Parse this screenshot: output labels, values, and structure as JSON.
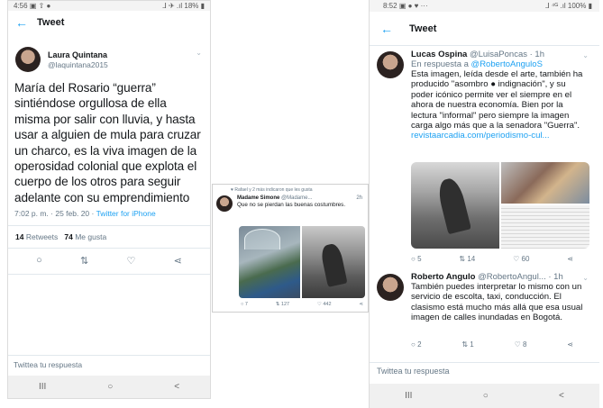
{
  "phone1": {
    "status": {
      "time": "4:56",
      "left_icons": "▣ ⇧ ●",
      "right": "⅃ ✈ .ıl 18% ▮"
    },
    "header": {
      "back": "←",
      "title": "Tweet"
    },
    "tweet": {
      "author_name": "Laura Quintana",
      "author_handle": "@laquintana2015",
      "text": "María del Rosario “guerra” sintiéndose orgullosa de ella misma por salir con lluvia, y hasta usar a alguien de mula para cruzar un charco, es la viva imagen de la operosidad colonial que explota el cuerpo de los otros para seguir adelante con su emprendimiento",
      "time": "7:02 p. m. · 25 feb. 20 ·",
      "source": "Twitter for iPhone",
      "retweets": "14",
      "retweets_label": "Retweets",
      "likes": "74",
      "likes_label": "Me gusta"
    },
    "actions": [
      "○",
      "⇅",
      "♡",
      "⋖"
    ],
    "reply_placeholder": "Twittea tu respuesta",
    "nav": [
      "III",
      "○",
      "<"
    ]
  },
  "card": {
    "liked_by": "♥  Rafael y 2 más indicaron que les gusta",
    "author": "Madame Simone",
    "handle": "@Madame...",
    "time": "2h",
    "text": "Que no se pierdan las buenas costumbres.",
    "replies": "7",
    "retweets": "127",
    "likes": "442"
  },
  "phone2": {
    "status": {
      "time": "8:52",
      "left_icons": "▣ ● ♥ ···",
      "right": "⅃ ⁴ᴳ .ıl 100% ▮"
    },
    "header": {
      "back": "←",
      "title": "Tweet"
    },
    "tweet1": {
      "author_name": "Lucas Ospina",
      "handle_time": "@LuisaPoncas · 1h",
      "reply_prefix": "En respuesta a",
      "reply_to": "@RobertoAnguloS",
      "text": "Esta imagen, leída desde el arte, también ha producido \"asombro ● indignación\", y su poder icónico permite ver el siempre en el ahora de nuestra economía. Bien por la lectura \"informal\" pero siempre la imagen carga algo más que a la senadora \"Guerra\".",
      "link": "revistaarcadia.com/periodismo-cul...",
      "replies": "5",
      "retweets": "14",
      "likes": "60"
    },
    "tweet2": {
      "author_name": "Roberto Angulo",
      "handle_time": "@RobertoAngul... · 1h",
      "text": "También puedes interpretar lo mismo con un servicio de escolta, taxi, conducción. El clasismo está mucho más allá que esa usual imagen de calles inundadas en Bogotá.",
      "replies": "2",
      "retweets": "1",
      "likes": "8"
    },
    "reply_placeholder": "Twittea tu respuesta",
    "nav": [
      "III",
      "○",
      "<"
    ]
  }
}
